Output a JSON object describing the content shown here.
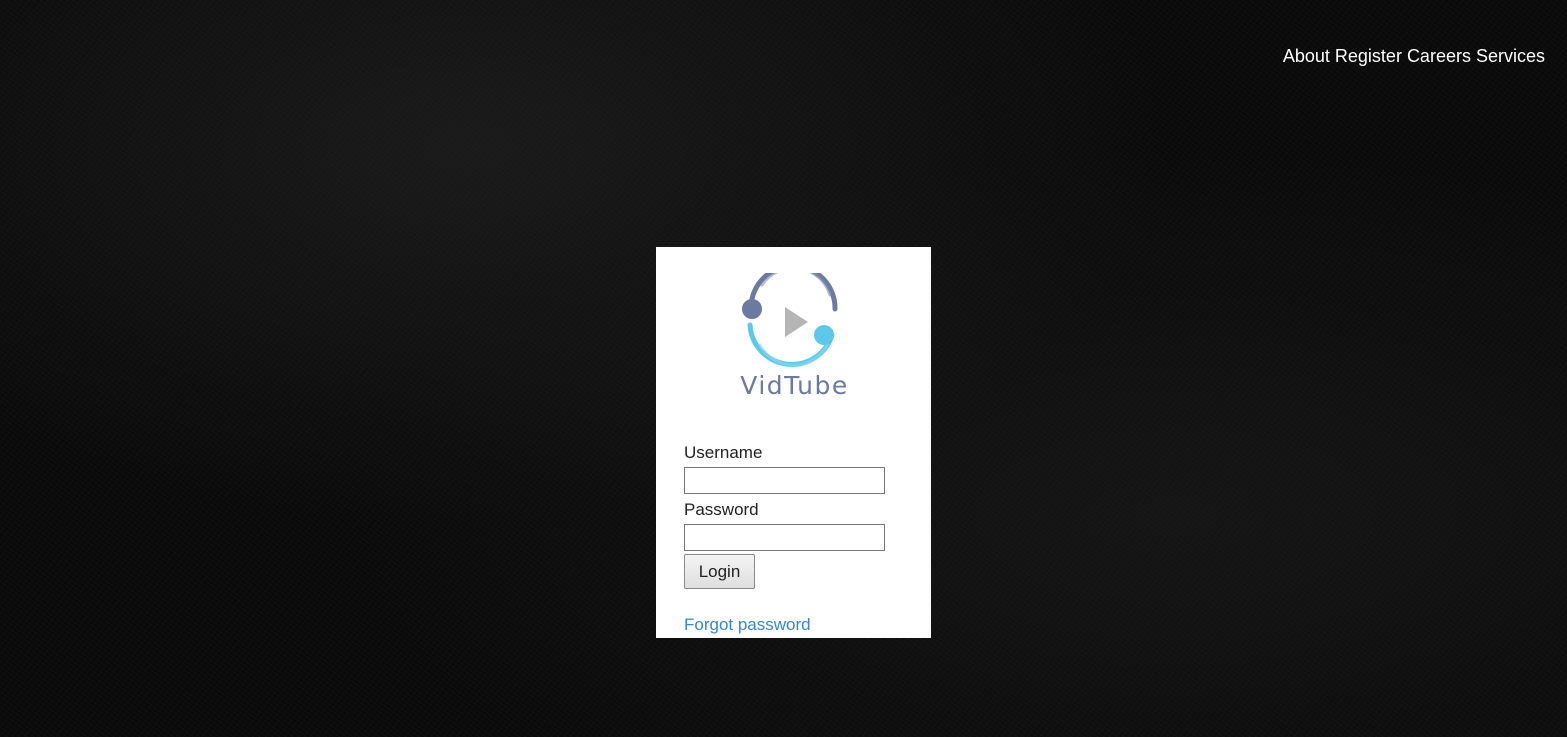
{
  "nav": {
    "items": [
      {
        "label": "About"
      },
      {
        "label": "Register"
      },
      {
        "label": "Careers"
      },
      {
        "label": "Services"
      }
    ]
  },
  "brand": {
    "name": "VidTube",
    "icon": "vidtube-logo-icon",
    "colors": {
      "dark_blue": "#6b7aa1",
      "light_blue": "#5bc8ec",
      "play_gray": "#b5b5b5"
    }
  },
  "login": {
    "username_label": "Username",
    "username_value": "",
    "password_label": "Password",
    "password_value": "",
    "login_button": "Login",
    "forgot_link": "Forgot password",
    "link_color": "#3a86c8"
  }
}
